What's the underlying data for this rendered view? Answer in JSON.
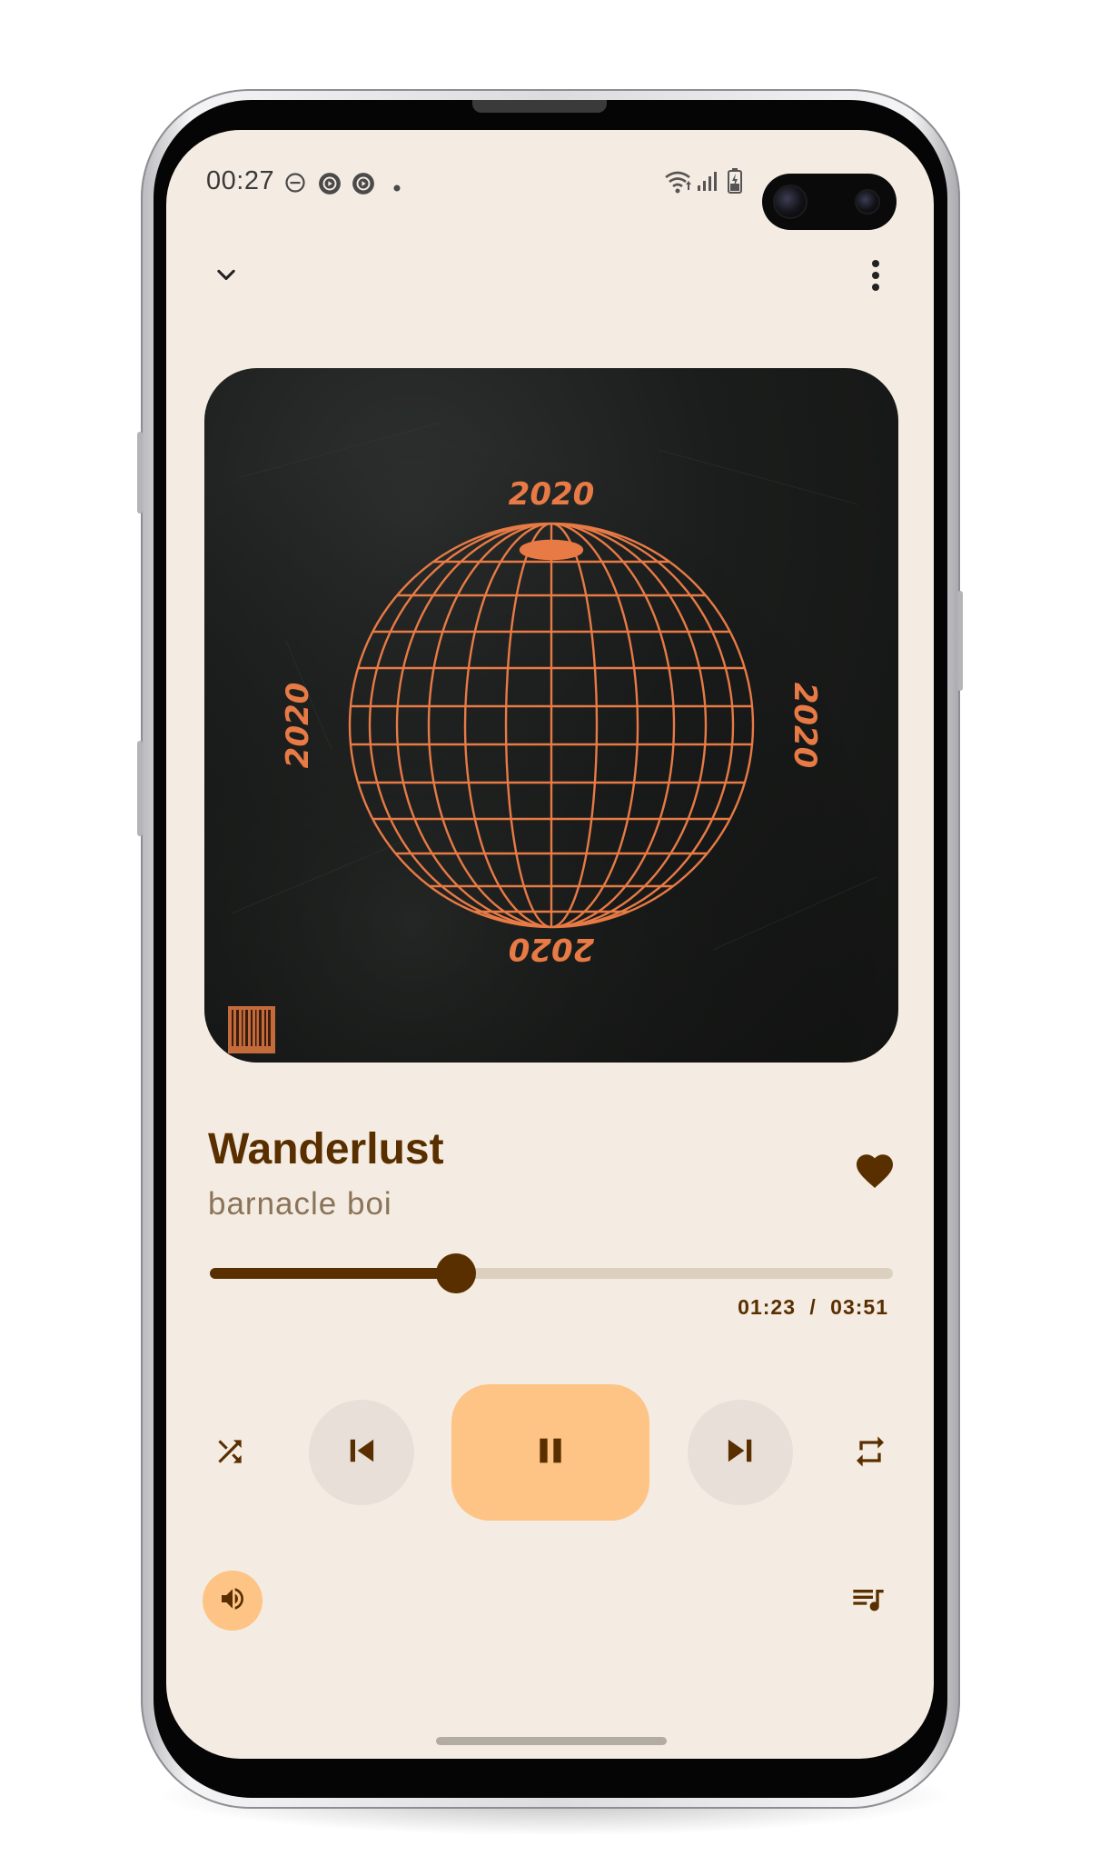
{
  "status_bar": {
    "time": "00:27"
  },
  "top_bar": {
    "collapse_icon": "chevron-down-icon",
    "menu_icon": "more-vert-icon"
  },
  "album_art": {
    "text_top": "2020",
    "text_left": "2020",
    "text_right": "2020",
    "text_bottom": "2020"
  },
  "track": {
    "title": "Wanderlust",
    "artist": "barnacle boi",
    "favorited": true
  },
  "progress": {
    "current": "01:23",
    "separator": "/",
    "total": "03:51",
    "fraction": 0.36
  },
  "controls": {
    "shuffle_icon": "shuffle-icon",
    "previous_icon": "skip-previous-icon",
    "play_state_icon": "pause-icon",
    "next_icon": "skip-next-icon",
    "repeat_icon": "repeat-icon",
    "volume_icon": "volume-icon",
    "queue_icon": "queue-music-icon"
  },
  "colors": {
    "background": "#f4ece2",
    "primary": "#5a2f00",
    "accent": "#fdc485",
    "secondary_button": "#e8e0d8",
    "artwork_orange": "#e87a45"
  }
}
